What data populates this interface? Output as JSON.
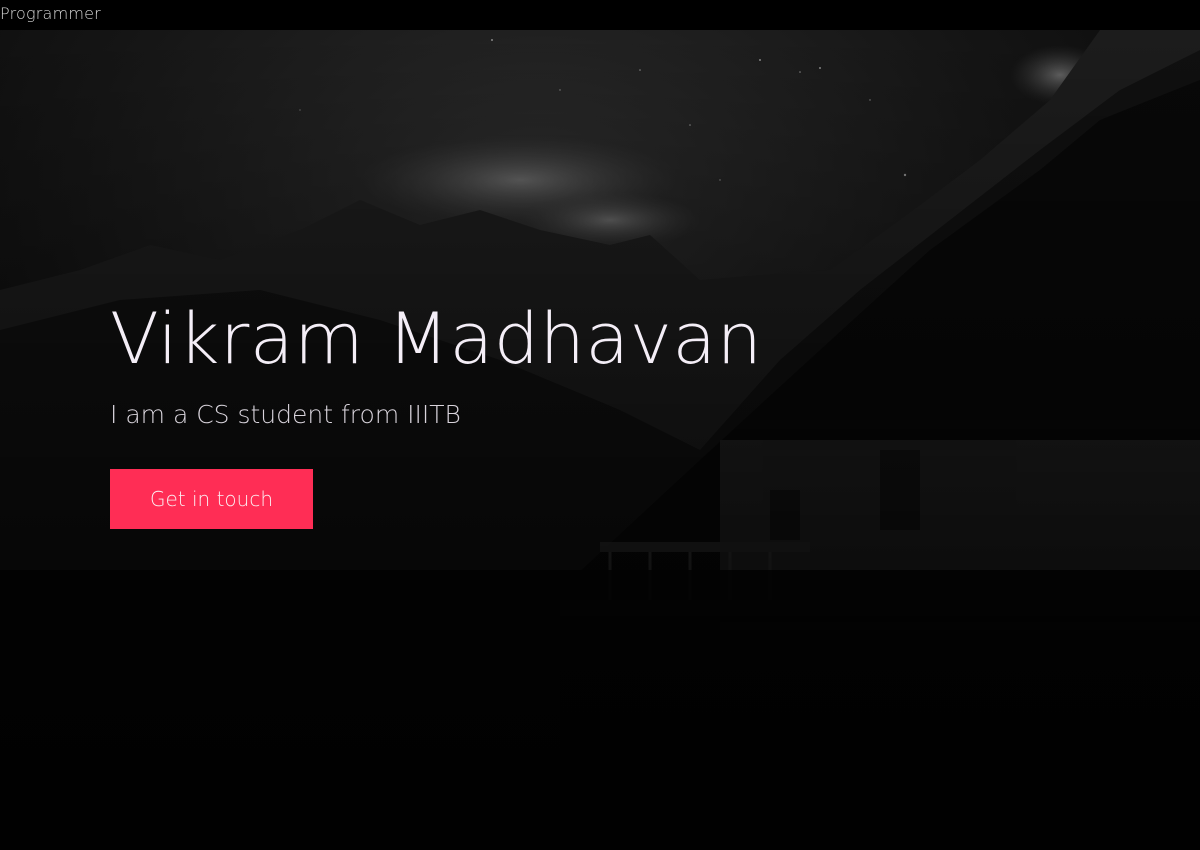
{
  "top_label": "Programmer",
  "hero": {
    "name": "Vikram Madhavan",
    "tagline": "I am a CS student from IIITB",
    "cta_label": "Get in touch"
  },
  "colors": {
    "accent": "#ff2d55",
    "background": "#000000",
    "title_text": "#f4eef7"
  },
  "background_image": "night-mountain-lake-cabin"
}
